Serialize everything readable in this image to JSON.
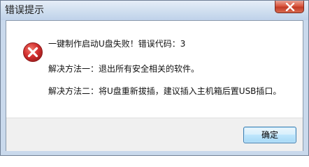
{
  "window": {
    "title": "错误提示"
  },
  "dialog": {
    "icon": "error-x-icon",
    "message_line1": "一键制作启动U盘失败！错误代码：3",
    "message_line2": "解决方法一：退出所有安全相关的软件。",
    "message_line3": "解决方法二：将U盘重新拔插，建议插入主机箱后置USB插口。",
    "ok_label": "确定"
  },
  "colors": {
    "title_bar": "#c9d9ec",
    "close_button": "#c9422c",
    "error_icon": "#d32f2f",
    "ok_button_border": "#3c7fb1"
  }
}
